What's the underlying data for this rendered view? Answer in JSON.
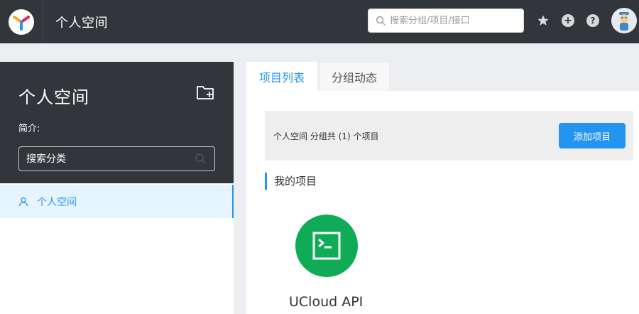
{
  "header": {
    "title": "个人空间",
    "search_placeholder": "搜索分组/项目/接口",
    "icons": [
      "star-icon",
      "plus-icon",
      "help-icon"
    ]
  },
  "sidebar": {
    "group_name": "个人空间",
    "description_label": "简介:",
    "search_placeholder": "搜索分类",
    "items": [
      {
        "label": "个人空间",
        "icon": "user-icon",
        "active": true
      }
    ]
  },
  "main": {
    "tabs": [
      {
        "label": "项目列表",
        "active": true
      },
      {
        "label": "分组动态",
        "active": false
      }
    ],
    "count_text": "个人空间 分组共 (1) 个项目",
    "add_button_label": "添加项目",
    "section_title": "我的项目",
    "projects": [
      {
        "name": "UCloud API",
        "icon": "terminal-icon",
        "color": "#0fab56"
      }
    ]
  },
  "colors": {
    "header_bg": "#32363a",
    "accent": "#2395f1",
    "project_green": "#0fab56"
  }
}
